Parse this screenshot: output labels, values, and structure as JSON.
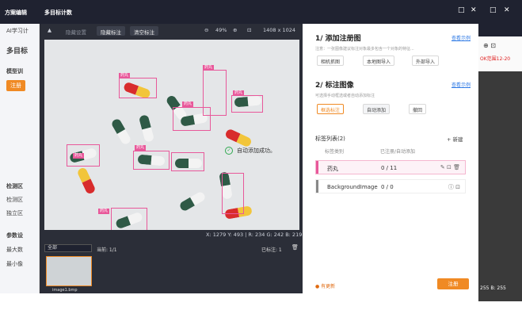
{
  "app_tab": "方案编辑",
  "dialog_title": "多目标计数",
  "window_controls": {
    "max": "□",
    "close": "✕"
  },
  "bg_left": {
    "item1": "AI学习计",
    "item2": "多目标",
    "item3": "模型训",
    "item4": "注册",
    "item5": "检测区",
    "item6": "检测区",
    "item7": "独立区",
    "item8": "参数设",
    "item9": "最大数",
    "item10": "最小像"
  },
  "bg_right": {
    "tools": "⊕ ⊡",
    "red_text": "OK范围12-20",
    "rgb": "255 B: 255"
  },
  "toolbar": {
    "select_icon": "▲",
    "btn1": "隐藏设置",
    "btn2": "隐藏标注",
    "btn3": "清空标注",
    "zoom": "49%",
    "size": "1408 x 1024"
  },
  "labels": {
    "tag": "药丸"
  },
  "toast": "自动添加成功。",
  "status": "X: 1279 Y: 493  |  R: 234 G: 242 B: 219",
  "thumb_bar": {
    "select": "全部",
    "current": "当前: 1/1",
    "marked": "已标注: 1"
  },
  "thumb_caption": "image1.bmp",
  "panel": {
    "sec1": {
      "title": "1/ 添加注册图",
      "link": "查看示例",
      "hint": "注意：一张图像建议标注对象最多包含一个对象的特征...",
      "b1": "相机抓图",
      "b2": "本地图导入",
      "b3": "外部导入"
    },
    "sec2": {
      "title": "2/ 标注图像",
      "link": "查看示例",
      "hint": "可选择手动框选或者自动添加标注",
      "b1": "框选标注",
      "b2": "自动添加",
      "b3": "撤回"
    },
    "list": {
      "title": "标签列表(2)",
      "add": "+ 新建",
      "col1": "标签类别",
      "col2": "已注册/自动添加",
      "rows": [
        {
          "name": "药丸",
          "count": "0 / 11",
          "color": "#e8589a"
        },
        {
          "name": "BackgroundImage",
          "count": "0 / 0",
          "color": "#888888"
        }
      ]
    },
    "update": "● 有更新",
    "submit": "注册"
  }
}
